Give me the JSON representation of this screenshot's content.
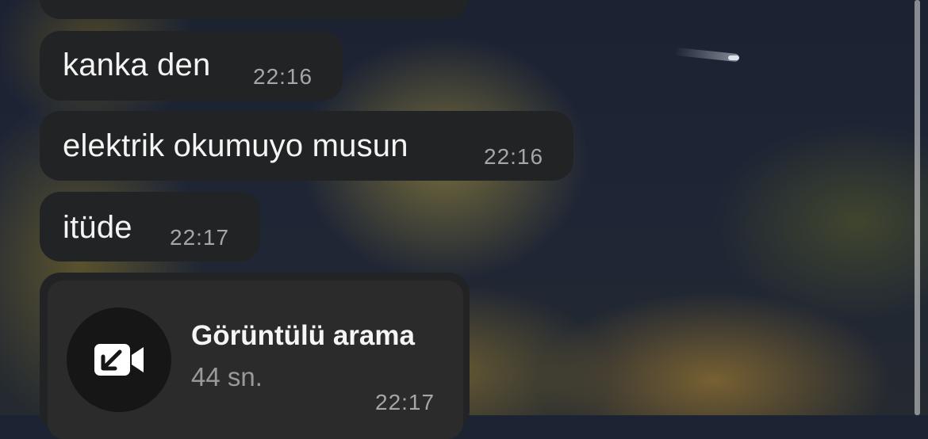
{
  "messages": [
    {
      "text": "kanka den",
      "time": "22:16"
    },
    {
      "text": "elektrik okumuyo musun",
      "time": "22:16"
    },
    {
      "text": "itüde",
      "time": "22:17"
    }
  ],
  "call": {
    "title": "Görüntülü arama",
    "duration": "44 sn.",
    "time": "22:17",
    "icon": "incoming-video-call-icon"
  },
  "colors": {
    "bubble": "#222324",
    "call_card": "#2b2b2c",
    "timestamp": "#a6a6a6"
  }
}
